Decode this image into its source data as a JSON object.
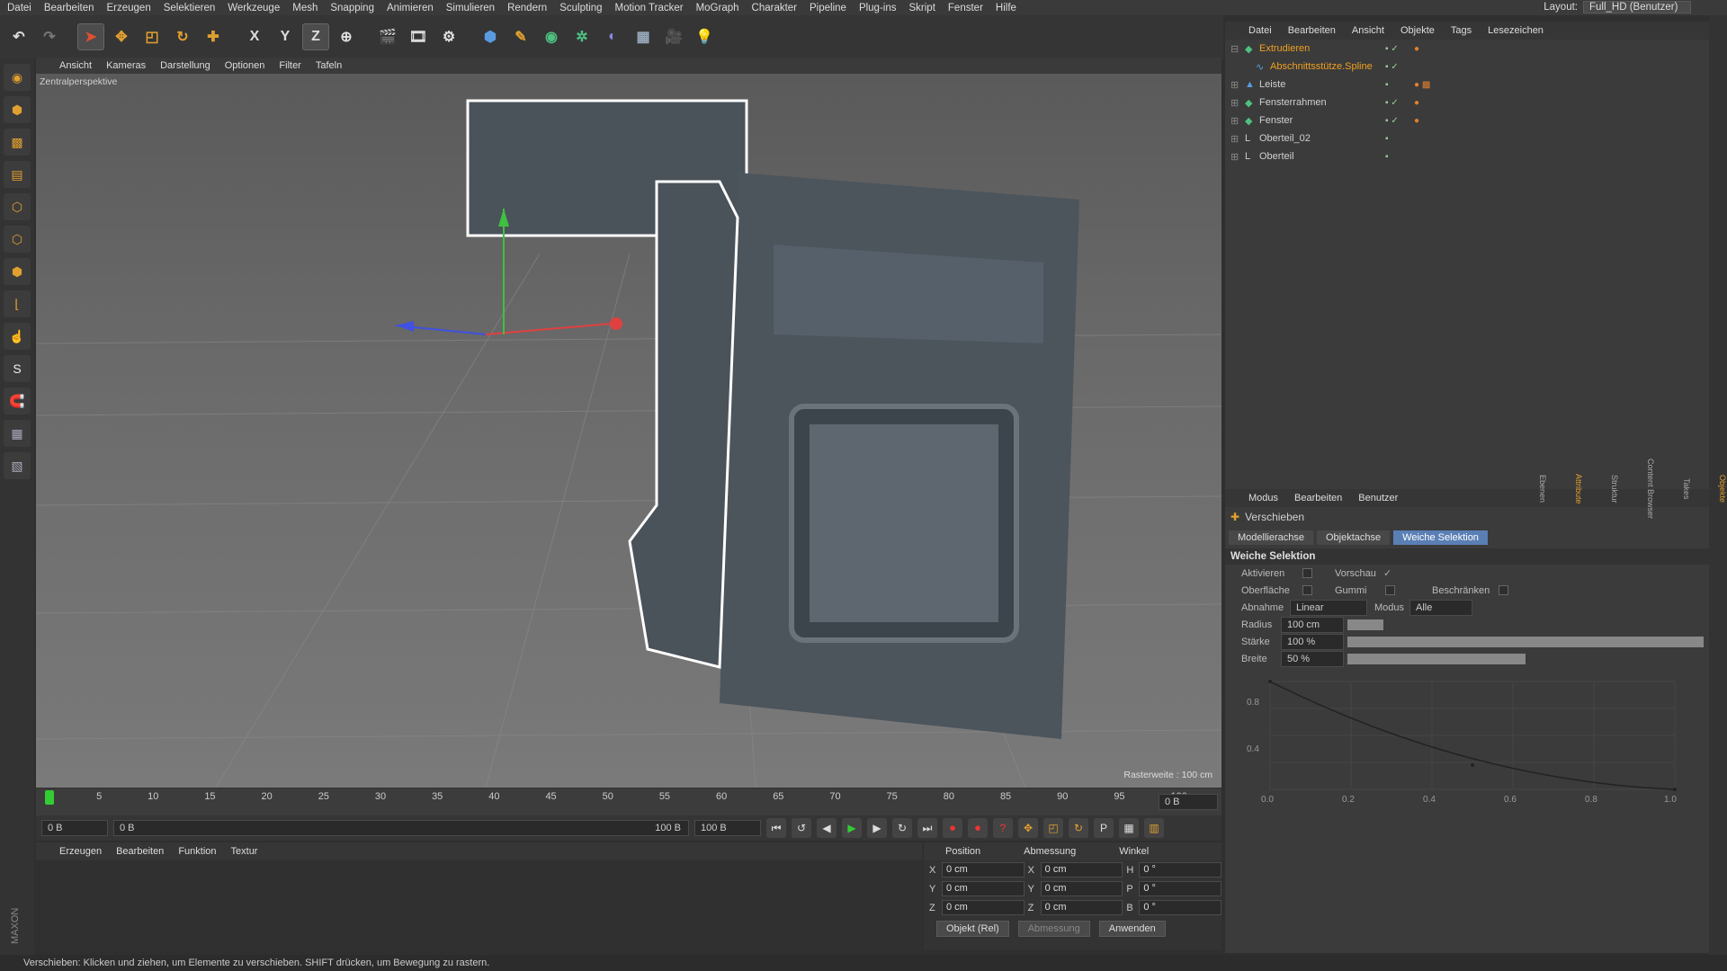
{
  "menubar": {
    "items": [
      "Datei",
      "Bearbeiten",
      "Erzeugen",
      "Selektieren",
      "Werkzeuge",
      "Mesh",
      "Snapping",
      "Animieren",
      "Simulieren",
      "Rendern",
      "Sculpting",
      "Motion Tracker",
      "MoGraph",
      "Charakter",
      "Pipeline",
      "Plug-ins",
      "Skript",
      "Fenster",
      "Hilfe"
    ],
    "layout_label": "Layout:",
    "layout_value": "Full_HD (Benutzer)"
  },
  "toolbar": {
    "axis_x": "X",
    "axis_y": "Y",
    "axis_z": "Z"
  },
  "viewport": {
    "menu": [
      "Ansicht",
      "Kameras",
      "Darstellung",
      "Optionen",
      "Filter",
      "Tafeln"
    ],
    "view_name": "Zentralperspektive",
    "grid_spacing": "Rasterweite : 100 cm"
  },
  "timeline": {
    "ticks": [
      "0",
      "5",
      "10",
      "15",
      "20",
      "25",
      "30",
      "35",
      "40",
      "45",
      "50",
      "55",
      "60",
      "65",
      "70",
      "75",
      "80",
      "85",
      "90",
      "95",
      "100"
    ],
    "current_frame": "0 B"
  },
  "anim": {
    "start": "0 B",
    "range_start": "0 B",
    "range_end": "100 B",
    "end": "100 B"
  },
  "material": {
    "menu": [
      "Erzeugen",
      "Bearbeiten",
      "Funktion",
      "Textur"
    ]
  },
  "coords": {
    "headers": [
      "Position",
      "Abmessung",
      "Winkel"
    ],
    "rows": [
      {
        "a": "X",
        "pos": "0 cm",
        "b": "X",
        "size": "0 cm",
        "c": "H",
        "rot": "0 °"
      },
      {
        "a": "Y",
        "pos": "0 cm",
        "b": "Y",
        "size": "0 cm",
        "c": "P",
        "rot": "0 °"
      },
      {
        "a": "Z",
        "pos": "0 cm",
        "b": "Z",
        "size": "0 cm",
        "c": "B",
        "rot": "0 °"
      }
    ],
    "mode": "Objekt (Rel)",
    "size_mode": "Abmessung",
    "apply": "Anwenden"
  },
  "objects": {
    "menu": [
      "Datei",
      "Bearbeiten",
      "Ansicht",
      "Objekte",
      "Tags",
      "Lesezeichen"
    ],
    "items": [
      {
        "name": "Extrudieren",
        "color": "#f0a020"
      },
      {
        "name": "Abschnittsstütze.Spline",
        "color": "#f0a020"
      },
      {
        "name": "Leiste",
        "color": "#d0d0d0"
      },
      {
        "name": "Fensterrahmen",
        "color": "#d0d0d0"
      },
      {
        "name": "Fenster",
        "color": "#d0d0d0"
      },
      {
        "name": "Oberteil_02",
        "color": "#d0d0d0"
      },
      {
        "name": "Oberteil",
        "color": "#d0d0d0"
      }
    ]
  },
  "attributes": {
    "menu": [
      "Modus",
      "Bearbeiten",
      "Benutzer"
    ],
    "tool": "Verschieben",
    "tabs": [
      "Modellierachse",
      "Objektachse",
      "Weiche Selektion"
    ],
    "section": "Weiche Selektion",
    "aktivieren": "Aktivieren",
    "vorschau": "Vorschau",
    "oberflaeche": "Oberfläche",
    "gummi": "Gummi",
    "beschraenken": "Beschränken",
    "abnahme": "Abnahme",
    "abnahme_value": "Linear",
    "modus": "Modus",
    "modus_value": "Alle",
    "radius": "Radius",
    "radius_value": "100 cm",
    "staerke": "Stärke",
    "staerke_value": "100 %",
    "breite": "Breite",
    "breite_value": "50 %",
    "graph_y": [
      "0.8",
      "0.4"
    ],
    "graph_x": [
      "0.0",
      "0.2",
      "0.4",
      "0.6",
      "0.8",
      "1.0"
    ]
  },
  "right_strip": [
    "Objekte",
    "Takes",
    "Content Browser",
    "Struktur",
    "Attribute",
    "Ebenen"
  ],
  "status": "Verschieben: Klicken und ziehen, um Elemente zu verschieben. SHIFT drücken, um Bewegung zu rastern."
}
